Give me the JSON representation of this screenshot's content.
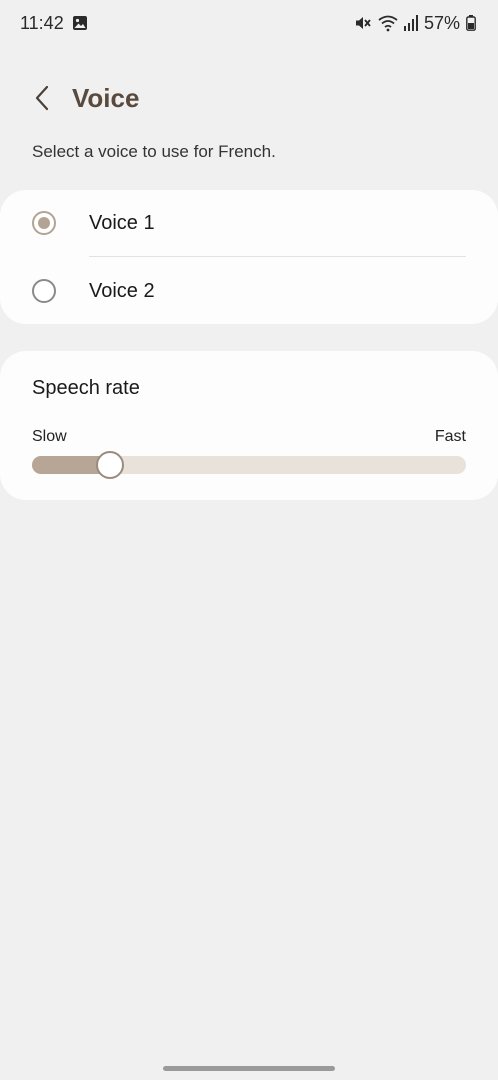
{
  "status_bar": {
    "time": "11:42",
    "battery": "57%",
    "icons": [
      "image-icon",
      "mute-icon",
      "wifi-icon",
      "signal-icon",
      "battery-icon"
    ]
  },
  "header": {
    "title": "Voice",
    "back_icon": "chevron-left-icon"
  },
  "subtitle": "Select a voice to use for French.",
  "voices": [
    {
      "label": "Voice 1",
      "selected": true
    },
    {
      "label": "Voice 2",
      "selected": false
    }
  ],
  "speech_rate": {
    "title": "Speech rate",
    "min_label": "Slow",
    "max_label": "Fast",
    "value_fraction": 0.18
  },
  "colors": {
    "accent": "#b3a394",
    "title": "#5a4a3e",
    "background": "#f0f0f0",
    "card": "#fdfdfd"
  }
}
